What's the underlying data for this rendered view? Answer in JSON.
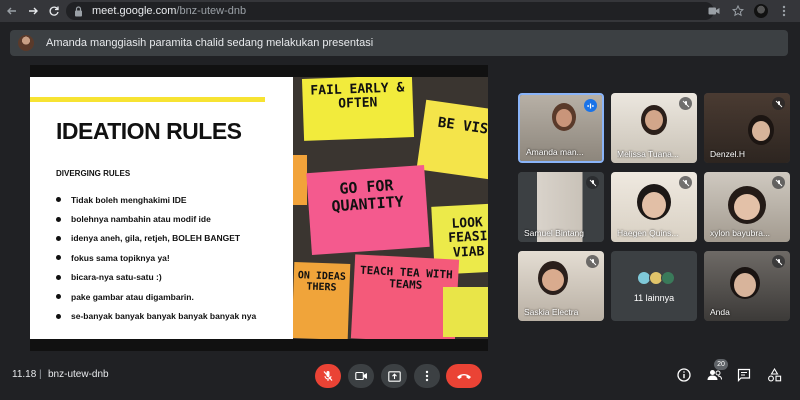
{
  "browser": {
    "url_host": "meet.google.com",
    "url_path": "/bnz-utew-dnb"
  },
  "presentation_bar": {
    "text": "Amanda manggiasih paramita chalid sedang melakukan presentasi"
  },
  "slide": {
    "title": "IDEATION RULES",
    "subtitle": "DIVERGING RULES",
    "rules": [
      "Tidak boleh menghakimi IDE",
      "bolehnya nambahin atau modif ide",
      "idenya aneh, gila, retjeh, BOLEH BANGET",
      "fokus sama topiknya ya!",
      "bicara-nya satu-satu :)",
      "pake gambar atau digambarin.",
      "se-banyak banyak banyak banyak banyak nya"
    ],
    "notes": {
      "fail_early": "FAIL EARLY & OFTEN",
      "be_visual": "BE VIS",
      "go_for_quantity": "GO FOR QUANTITY",
      "look": "LOOK FEASI VIAB",
      "teach": "TEACH TEA WITH TEAMS",
      "ideas": "ON IDEAS THERS"
    }
  },
  "participants": [
    {
      "name": "Amanda man...",
      "status": "speaking"
    },
    {
      "name": "Melissa Tuana...",
      "status": "muted"
    },
    {
      "name": "Denzel.H",
      "status": "muted"
    },
    {
      "name": "Samuel Bintang",
      "status": "muted"
    },
    {
      "name": "Haegen Quins...",
      "status": "muted"
    },
    {
      "name": "xylon bayubra...",
      "status": "muted"
    },
    {
      "name": "Saskia Electra",
      "status": "muted"
    },
    {
      "name": "11 lainnya",
      "status": "others"
    },
    {
      "name": "Anda",
      "status": "muted"
    }
  ],
  "bottom_bar": {
    "time": "11.18",
    "separator": "|",
    "meeting_code": "bnz-utew-dnb",
    "people_count": "20"
  },
  "icons": {
    "back": "arrow-left-icon",
    "forward": "arrow-right-icon",
    "reload": "reload-icon",
    "lock": "lock-icon",
    "camera_indicator": "video-camera-icon",
    "star": "star-icon",
    "mic_off": "mic-off-icon",
    "camera": "camera-icon",
    "present": "present-screen-icon",
    "more": "more-vert-icon",
    "end_call": "end-call-icon",
    "info": "info-icon",
    "people": "people-icon",
    "chat": "chat-icon",
    "activities": "activities-icon"
  },
  "colors": {
    "background": "#202124",
    "accent_blue": "#8ab4f8",
    "danger_red": "#ea4335",
    "slide_yellow": "#f7e332"
  }
}
